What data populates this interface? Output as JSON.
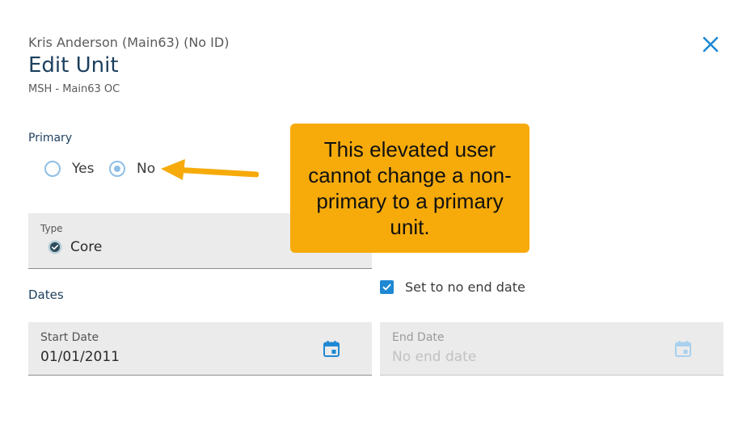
{
  "header": {
    "person": "Kris Anderson (Main63) (No ID)",
    "title": "Edit Unit",
    "unit": "MSH - Main63 OC"
  },
  "icons": {
    "close": "close-icon",
    "calendar": "calendar-icon",
    "core": "verified-badge-icon",
    "checkbox": "checkmark-icon"
  },
  "primary": {
    "label": "Primary",
    "options": [
      {
        "label": "Yes",
        "selected": false
      },
      {
        "label": "No",
        "selected": true
      }
    ]
  },
  "type_field": {
    "label": "Type",
    "value": "Core"
  },
  "dates": {
    "label": "Dates",
    "no_end_date": {
      "label": "Set to no end date",
      "checked": true
    },
    "start": {
      "label": "Start Date",
      "value": "01/01/2011"
    },
    "end": {
      "label": "End Date",
      "placeholder": "No end date"
    }
  },
  "callout": {
    "text": "This elevated user cannot change a non-primary to a primary unit."
  },
  "colors": {
    "accent": "#1e88d3",
    "title": "#1c3f5e",
    "callout": "#f6ab0b",
    "radio": "#8fbfe6",
    "field_bg": "#ebebeb"
  }
}
